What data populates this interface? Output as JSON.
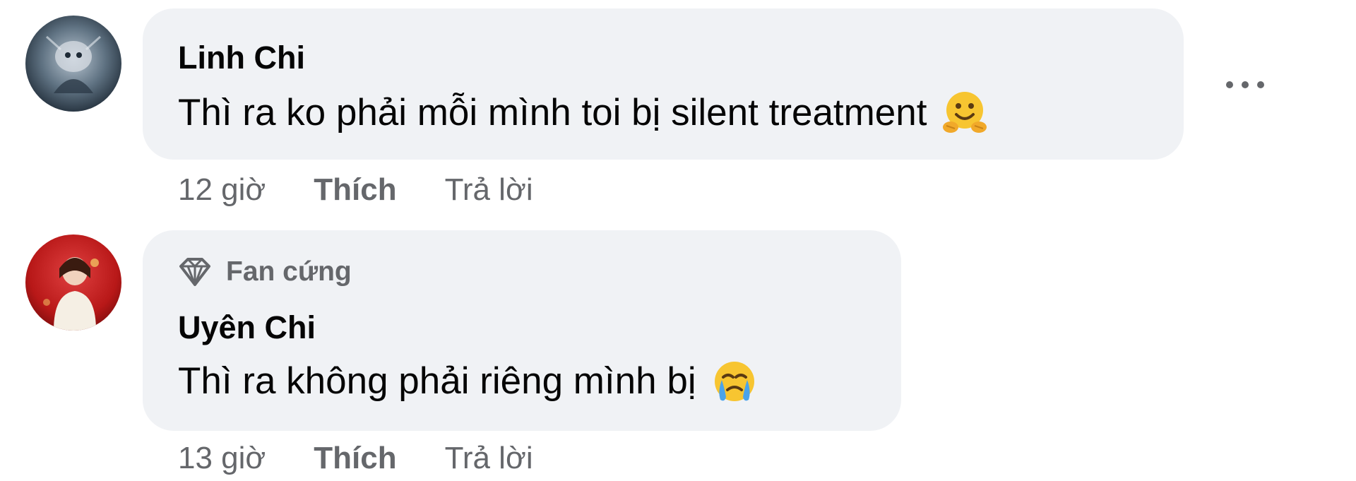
{
  "comments": [
    {
      "author": "Linh Chi",
      "text": "Thì ra ko phải mỗi mình toi bị silent treatment",
      "emoji": "hugging-face-icon",
      "time": "12 giờ",
      "like_label": "Thích",
      "reply_label": "Trả lời"
    },
    {
      "badge": "Fan cứng",
      "badge_icon": "diamond-icon",
      "author": "Uyên Chi",
      "text": "Thì ra không phải riêng mình bị",
      "emoji": "crying-face-icon",
      "time": "13 giờ",
      "like_label": "Thích",
      "reply_label": "Trả lời"
    }
  ],
  "more_icon": "more-options-icon",
  "colors": {
    "bubble": "#f0f2f5",
    "text": "#050505",
    "secondary": "#65676b"
  }
}
